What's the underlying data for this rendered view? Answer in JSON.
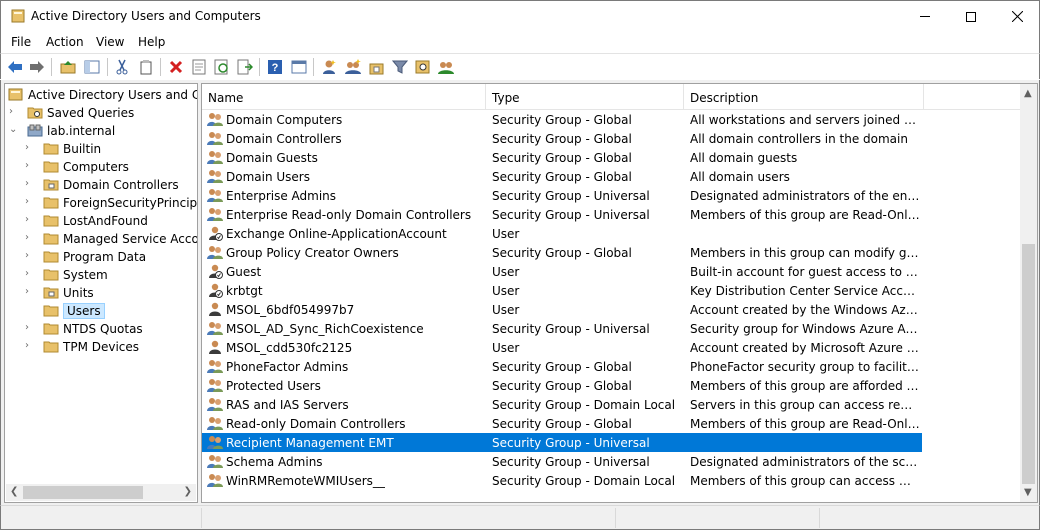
{
  "window": {
    "title": "Active Directory Users and Computers",
    "icon": "folder-book-icon"
  },
  "menu": [
    "File",
    "Action",
    "View",
    "Help"
  ],
  "toolbar": [
    "back-icon",
    "forward-icon",
    "up-folder-icon",
    "show-console-tree-icon",
    "cut-icon",
    "copy-icon",
    "delete-icon",
    "properties-icon",
    "refresh-icon",
    "export-list-icon",
    "help-icon",
    "mmc-icon",
    "new-user-icon",
    "new-group-icon",
    "new-ou-icon",
    "filter-icon",
    "find-icon",
    "add-to-group-icon"
  ],
  "tree": {
    "root": "Active Directory Users and Com",
    "items": [
      {
        "label": "Saved Queries",
        "level": 1,
        "expand": "›"
      },
      {
        "label": "lab.internal",
        "level": 1,
        "expand": "⌄"
      },
      {
        "label": "Builtin",
        "level": 2,
        "expand": "›"
      },
      {
        "label": "Computers",
        "level": 2,
        "expand": "›"
      },
      {
        "label": "Domain Controllers",
        "level": 2,
        "expand": "›"
      },
      {
        "label": "ForeignSecurityPrincipals",
        "level": 2,
        "expand": "›"
      },
      {
        "label": "LostAndFound",
        "level": 2,
        "expand": "›"
      },
      {
        "label": "Managed Service Accounts",
        "level": 2,
        "expand": "›"
      },
      {
        "label": "Program Data",
        "level": 2,
        "expand": "›"
      },
      {
        "label": "System",
        "level": 2,
        "expand": "›"
      },
      {
        "label": "Units",
        "level": 2,
        "expand": "›"
      },
      {
        "label": "Users",
        "level": 2,
        "expand": ""
      },
      {
        "label": "NTDS Quotas",
        "level": 2,
        "expand": "›"
      },
      {
        "label": "TPM Devices",
        "level": 2,
        "expand": "›"
      }
    ]
  },
  "list": {
    "columns": [
      "Name",
      "Type",
      "Description"
    ],
    "rows": [
      {
        "name": "Domain Computers",
        "type": "Security Group - Global",
        "description": "All workstations and servers joined to the ...",
        "icon": "group"
      },
      {
        "name": "Domain Controllers",
        "type": "Security Group - Global",
        "description": "All domain controllers in the domain",
        "icon": "group"
      },
      {
        "name": "Domain Guests",
        "type": "Security Group - Global",
        "description": "All domain guests",
        "icon": "group"
      },
      {
        "name": "Domain Users",
        "type": "Security Group - Global",
        "description": "All domain users",
        "icon": "group"
      },
      {
        "name": "Enterprise Admins",
        "type": "Security Group - Universal",
        "description": "Designated administrators of the enterprise",
        "icon": "group"
      },
      {
        "name": "Enterprise Read-only Domain Controllers",
        "type": "Security Group - Universal",
        "description": "Members of this group are Read-Only Do...",
        "icon": "group"
      },
      {
        "name": "Exchange Online-ApplicationAccount",
        "type": "User",
        "description": "",
        "icon": "user-disabled"
      },
      {
        "name": "Group Policy Creator Owners",
        "type": "Security Group - Global",
        "description": "Members in this group can modify group...",
        "icon": "group"
      },
      {
        "name": "Guest",
        "type": "User",
        "description": "Built-in account for guest access to the c...",
        "icon": "user-disabled"
      },
      {
        "name": "krbtgt",
        "type": "User",
        "description": "Key Distribution Center Service Account",
        "icon": "user-disabled"
      },
      {
        "name": "MSOL_6bdf054997b7",
        "type": "User",
        "description": "Account created by the Windows Azure A...",
        "icon": "user"
      },
      {
        "name": "MSOL_AD_Sync_RichCoexistence",
        "type": "Security Group - Universal",
        "description": "Security group for Windows Azure Active ...",
        "icon": "group"
      },
      {
        "name": "MSOL_cdd530fc2125",
        "type": "User",
        "description": "Account created by Microsoft Azure Activ...",
        "icon": "user"
      },
      {
        "name": "PhoneFactor Admins",
        "type": "Security Group - Global",
        "description": "PhoneFactor security group to facilitate ...",
        "icon": "group"
      },
      {
        "name": "Protected Users",
        "type": "Security Group - Global",
        "description": "Members of this group are afforded addit...",
        "icon": "group"
      },
      {
        "name": "RAS and IAS Servers",
        "type": "Security Group - Domain Local",
        "description": "Servers in this group can access remote a...",
        "icon": "group"
      },
      {
        "name": "Read-only Domain Controllers",
        "type": "Security Group - Global",
        "description": "Members of this group are Read-Only Do...",
        "icon": "group"
      },
      {
        "name": "Recipient Management EMT",
        "type": "Security Group - Universal",
        "description": "",
        "icon": "group",
        "selected": true
      },
      {
        "name": "Schema Admins",
        "type": "Security Group - Universal",
        "description": "Designated administrators of the schema",
        "icon": "group"
      },
      {
        "name": "WinRMRemoteWMIUsers__",
        "type": "Security Group - Domain Local",
        "description": "Members of this group can access WMI r...",
        "icon": "group"
      }
    ]
  },
  "colors": {
    "selection": "#0078d7",
    "tree_selection": "#cce8ff",
    "folder": "#e8c16a"
  }
}
